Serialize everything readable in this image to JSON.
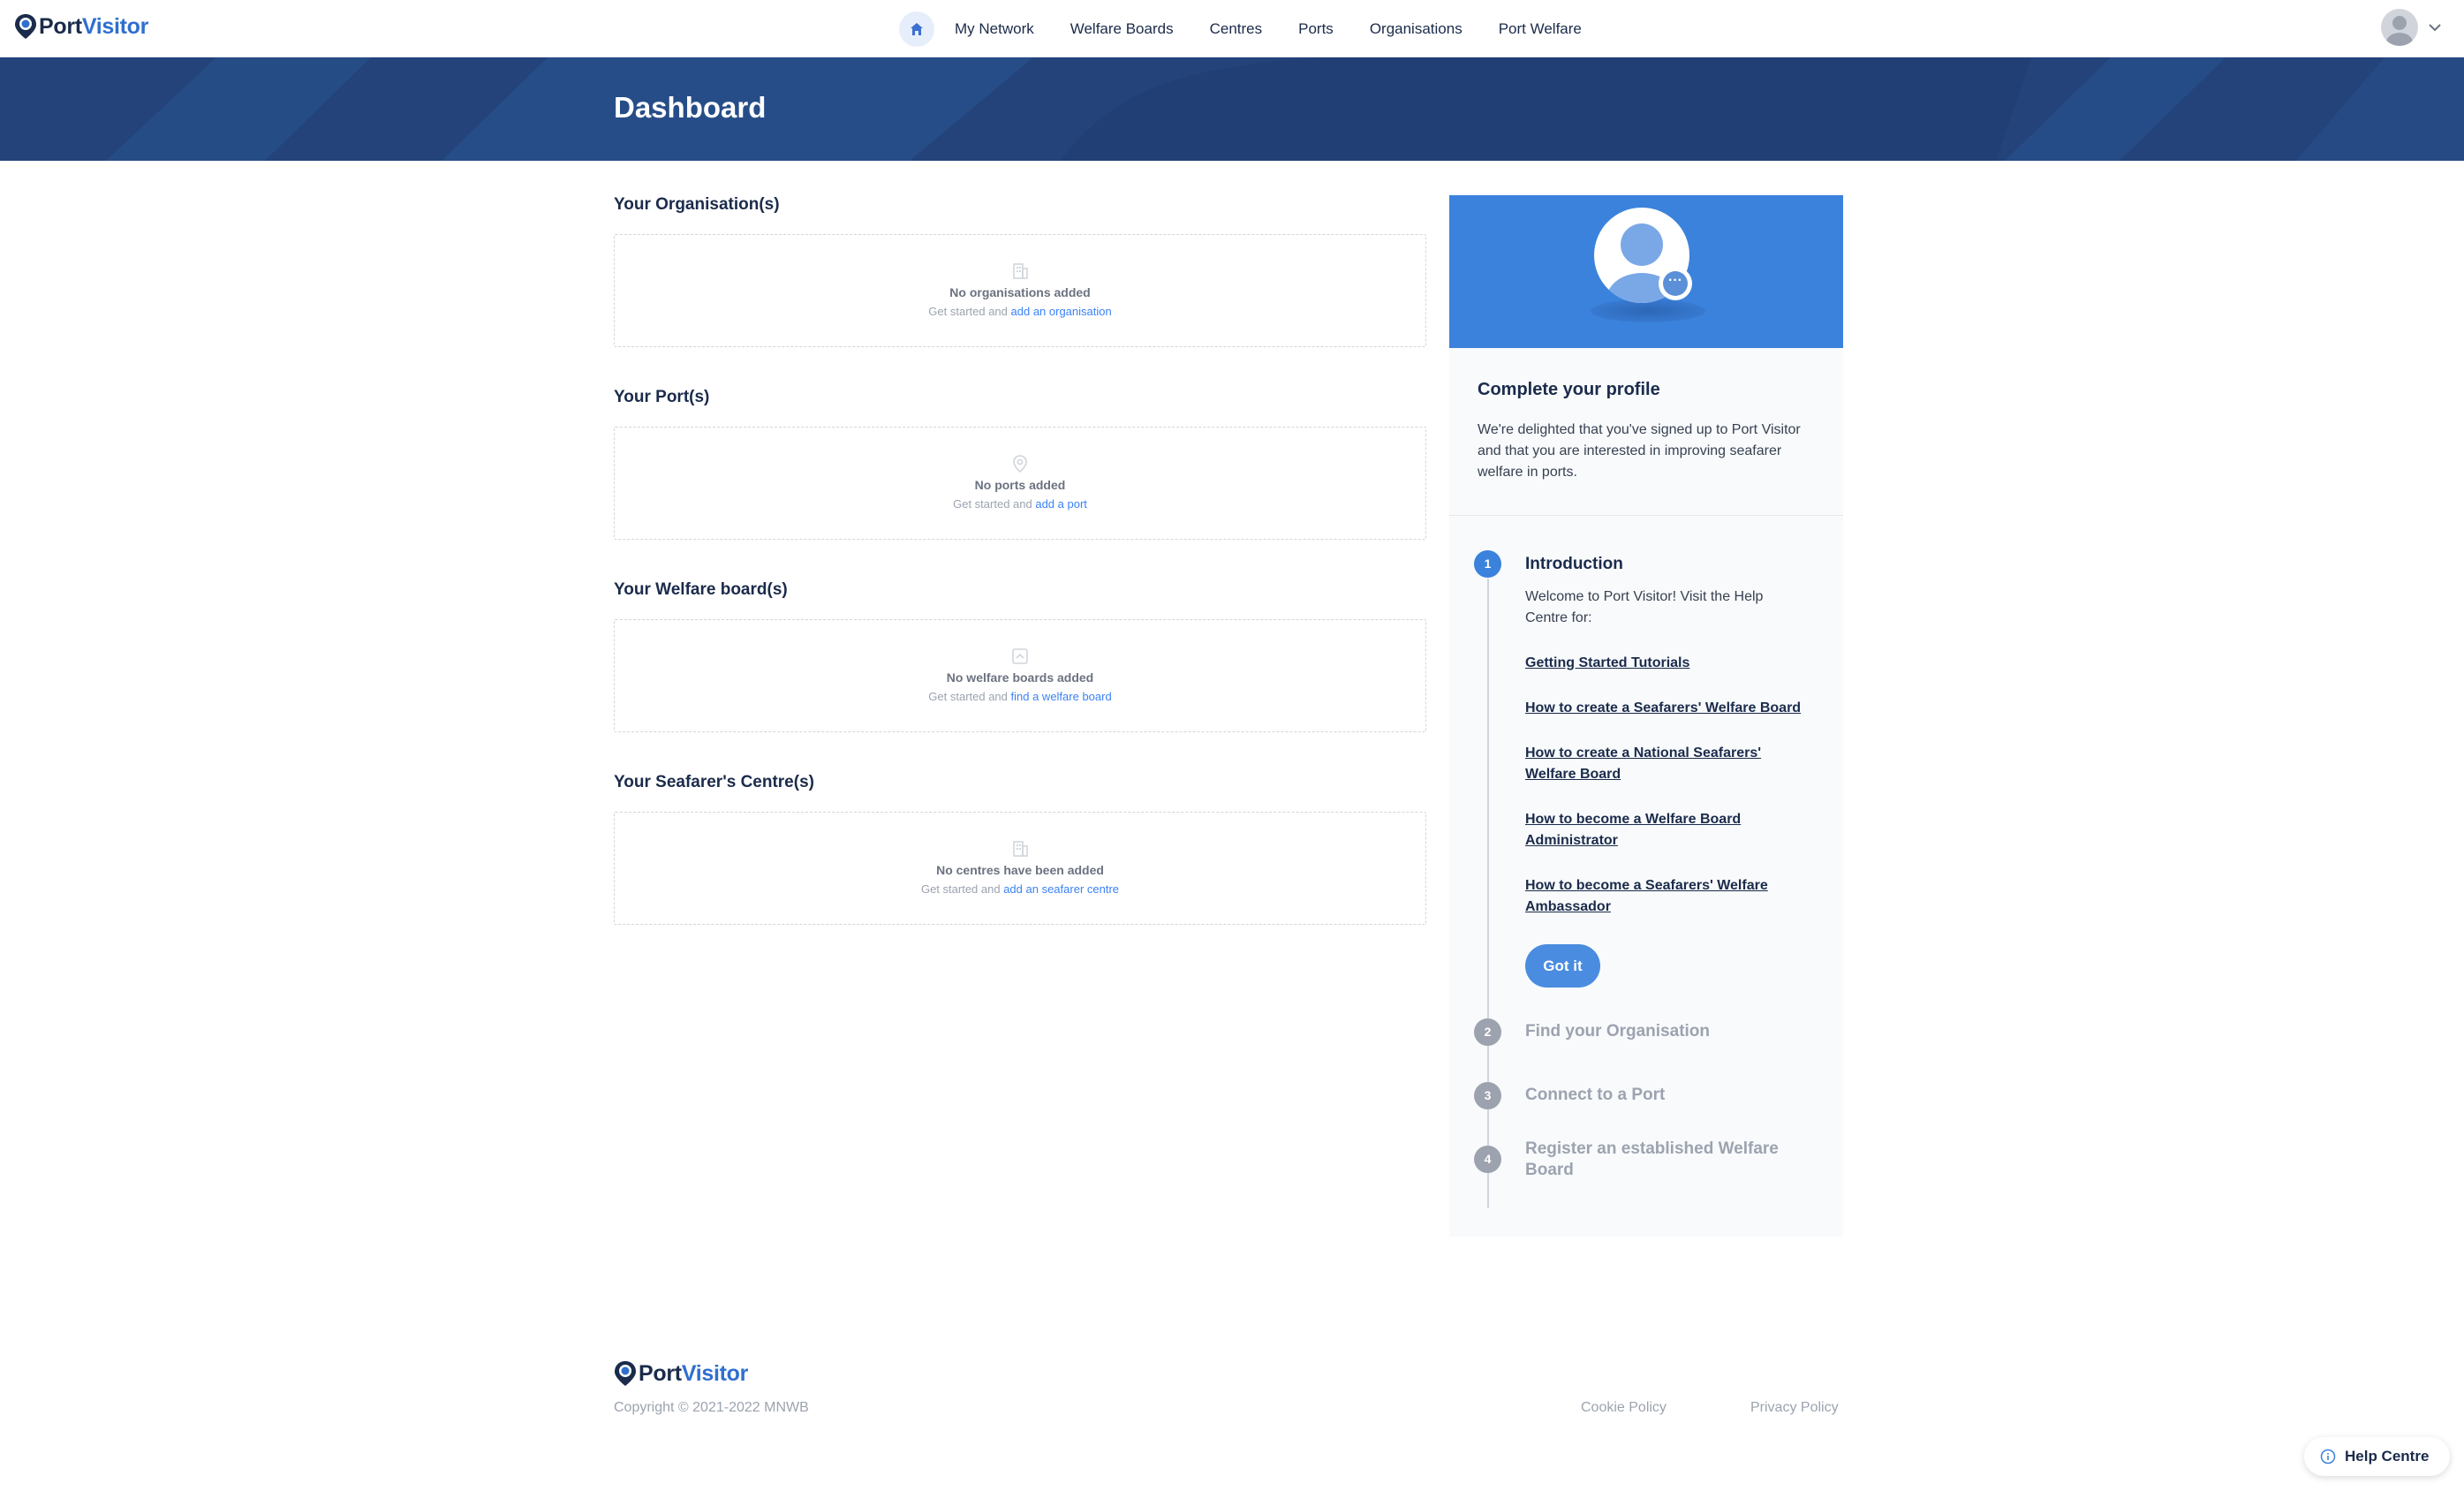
{
  "brand": {
    "part1": "Port",
    "part2": "Visitor"
  },
  "nav": {
    "home_icon": "home-icon",
    "links": [
      "My Network",
      "Welfare Boards",
      "Centres",
      "Ports",
      "Organisations",
      "Port Welfare"
    ]
  },
  "banner": {
    "title": "Dashboard"
  },
  "sections": [
    {
      "title": "Your Organisation(s)",
      "icon": "building-icon",
      "empty": "No organisations added",
      "prefix": "Get started and ",
      "link": "add an organisation"
    },
    {
      "title": "Your Port(s)",
      "icon": "map-pin-icon",
      "empty": "No ports added",
      "prefix": "Get started and ",
      "link": "add a port"
    },
    {
      "title": "Your Welfare board(s)",
      "icon": "board-icon",
      "empty": "No welfare boards added",
      "prefix": "Get started and ",
      "link": "find a welfare board"
    },
    {
      "title": "Your Seafarer's Centre(s)",
      "icon": "building-icon",
      "empty": "No centres have been added",
      "prefix": "Get started and ",
      "link": "add an seafarer centre"
    }
  ],
  "profile": {
    "title": "Complete your profile",
    "text": "We're delighted that you've signed up to Port Visitor and that you are interested in improving seafarer welfare in ports.",
    "hero_dots": "···",
    "steps": [
      {
        "num": "1",
        "title": "Introduction"
      },
      {
        "num": "2",
        "title": "Find your Organisation"
      },
      {
        "num": "3",
        "title": "Connect to a Port"
      },
      {
        "num": "4",
        "title": "Register an established Welfare Board"
      }
    ],
    "intro_text": "Welcome to Port Visitor! Visit the Help Centre for:",
    "help_links": [
      "Getting Started Tutorials",
      "How to create a Seafarers' Welfare Board",
      "How to create a National Seafarers' Welfare Board",
      "How to become a Welfare Board Administrator",
      "How to become a Seafarers' Welfare Ambassador"
    ],
    "got_it": "Got it"
  },
  "footer": {
    "copyright": "Copyright © 2021-2022 MNWB",
    "cookie": "Cookie Policy",
    "privacy": "Privacy Policy"
  },
  "help_centre": {
    "label": "Help Centre"
  },
  "colors": {
    "navy": "#1b2b4b",
    "brand_blue": "#2f6fce",
    "banner": "#23437a",
    "accent": "#3b82dc"
  }
}
